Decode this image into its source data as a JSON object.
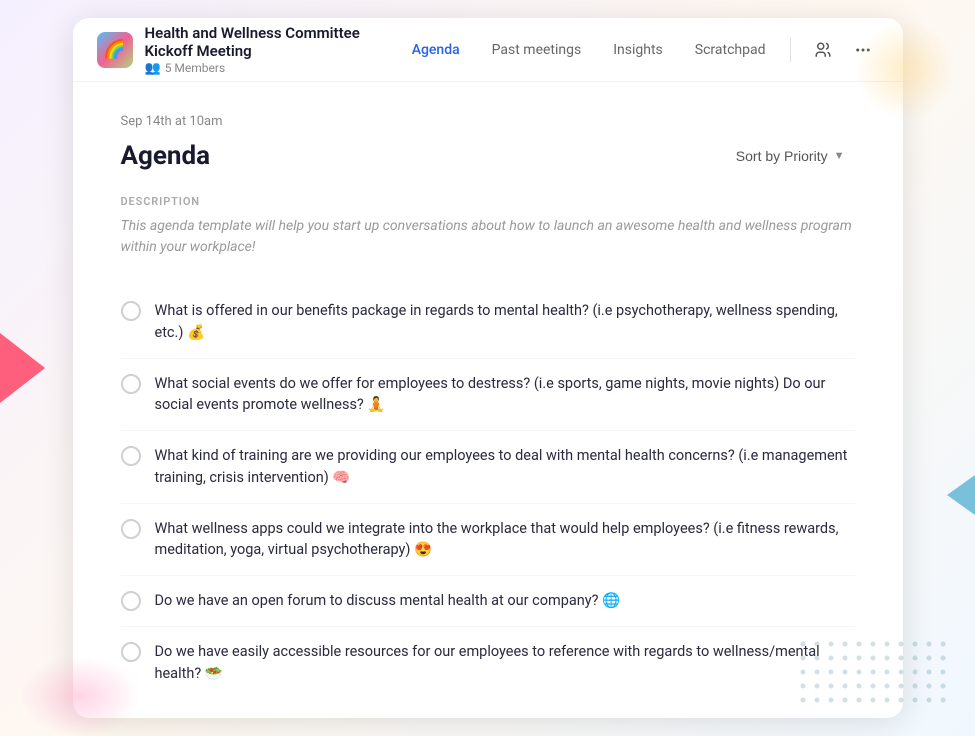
{
  "background": {
    "triangle_left_color": "#ff4466",
    "triangle_right_color": "#44aacc"
  },
  "header": {
    "logo_emoji": "🌈",
    "title": "Health and Wellness Committee Kickoff Meeting",
    "members_label": "5 Members",
    "nav": {
      "items": [
        {
          "id": "agenda",
          "label": "Agenda",
          "active": true
        },
        {
          "id": "past-meetings",
          "label": "Past meetings",
          "active": false
        },
        {
          "id": "insights",
          "label": "Insights",
          "active": false
        },
        {
          "id": "scratchpad",
          "label": "Scratchpad",
          "active": false
        }
      ]
    },
    "action_person_icon": "👤",
    "action_more_icon": "···"
  },
  "main": {
    "date": "Sep 14th at 10am",
    "title": "Agenda",
    "sort_label": "Sort by Priority",
    "description_section": {
      "label": "DESCRIPTION",
      "text": "This agenda template will help you start up conversations about how to launch an awesome health and wellness program within your workplace!"
    },
    "items": [
      {
        "id": 1,
        "text": "What is offered in our benefits package in regards to mental health? (i.e psychotherapy, wellness spending, etc.) 💰"
      },
      {
        "id": 2,
        "text": "What social events do we offer for employees to destress? (i.e sports, game nights, movie nights) Do our social events promote wellness? 🧘"
      },
      {
        "id": 3,
        "text": "What kind of training are we providing our employees to deal with mental health concerns? (i.e management training, crisis intervention) 🧠"
      },
      {
        "id": 4,
        "text": "What wellness apps could we integrate into the workplace that would help employees? (i.e fitness rewards, meditation, yoga, virtual psychotherapy) 😍"
      },
      {
        "id": 5,
        "text": "Do we have an open forum to discuss mental health at our company? 🌐"
      },
      {
        "id": 6,
        "text": "Do we have easily accessible resources for our employees to reference with regards to wellness/mental health? 🥗"
      }
    ]
  }
}
